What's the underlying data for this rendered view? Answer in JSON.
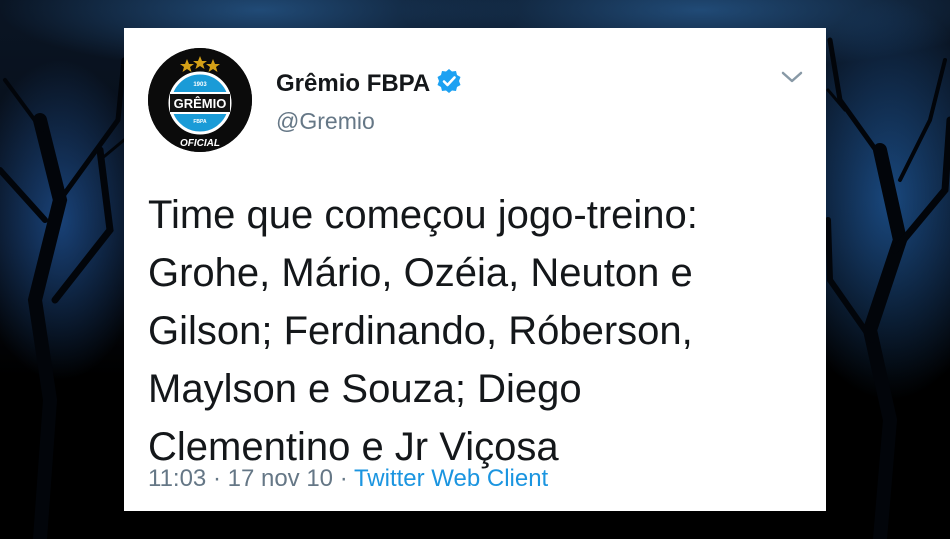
{
  "tweet": {
    "display_name": "Grêmio FBPA",
    "handle": "@Gremio",
    "text_lines": [
      "Time que começou jogo-treino:",
      "Grohe, Mário, Ozéia, Neuton e",
      "Gilson; Ferdinando, Róberson,",
      "Maylson e Souza; Diego",
      "Clementino e Jr Viçosa"
    ],
    "time": "11:03",
    "date": "17 nov 10",
    "separator": " · ",
    "source": "Twitter Web Client",
    "verified_icon": "verified-badge-icon",
    "menu_icon": "chevron-down-icon"
  },
  "avatar": {
    "logo_text": "GRÊMIO",
    "logo_year": "1903",
    "logo_sub": "FBPA",
    "logo_label": "OFICIAL"
  },
  "colors": {
    "accent": "#1b95e0",
    "text": "#14171a",
    "secondary": "#657786",
    "card": "#ffffff",
    "logo_blue": "#1a9bd7"
  }
}
